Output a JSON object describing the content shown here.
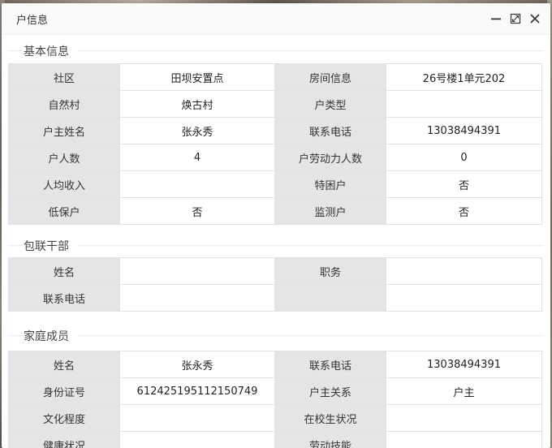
{
  "window": {
    "title": "户信息"
  },
  "sections": {
    "basic": {
      "title": "基本信息",
      "rows": [
        {
          "k1": "社区",
          "v1": "田坝安置点",
          "k2": "房间信息",
          "v2": "26号楼1单元202"
        },
        {
          "k1": "自然村",
          "v1": "焕古村",
          "k2": "户类型",
          "v2": ""
        },
        {
          "k1": "户主姓名",
          "v1": "张永秀",
          "k2": "联系电话",
          "v2": "13038494391"
        },
        {
          "k1": "户人数",
          "v1": "4",
          "k2": "户劳动力人数",
          "v2": "0"
        },
        {
          "k1": "人均收入",
          "v1": "",
          "k2": "特困户",
          "v2": "否"
        },
        {
          "k1": "低保户",
          "v1": "否",
          "k2": "监测户",
          "v2": "否"
        }
      ]
    },
    "cadre": {
      "title": "包联干部",
      "rows": [
        {
          "k1": "姓名",
          "v1": "",
          "k2": "职务",
          "v2": ""
        },
        {
          "k1": "联系电话",
          "v1": "",
          "k2": "",
          "v2": ""
        }
      ]
    },
    "family": {
      "title": "家庭成员",
      "rows": [
        {
          "k1": "姓名",
          "v1": "张永秀",
          "k2": "联系电话",
          "v2": "13038494391"
        },
        {
          "k1": "身份证号",
          "v1": "612425195112150749",
          "k2": "户主关系",
          "v2": "户主"
        },
        {
          "k1": "文化程度",
          "v1": "",
          "k2": "在校生状况",
          "v2": ""
        },
        {
          "k1": "健康状况",
          "v1": "",
          "k2": "劳动技能",
          "v2": ""
        }
      ]
    }
  },
  "icons": {
    "minimize": "minimize-icon",
    "maximize": "maximize-icon",
    "close": "close-icon"
  }
}
